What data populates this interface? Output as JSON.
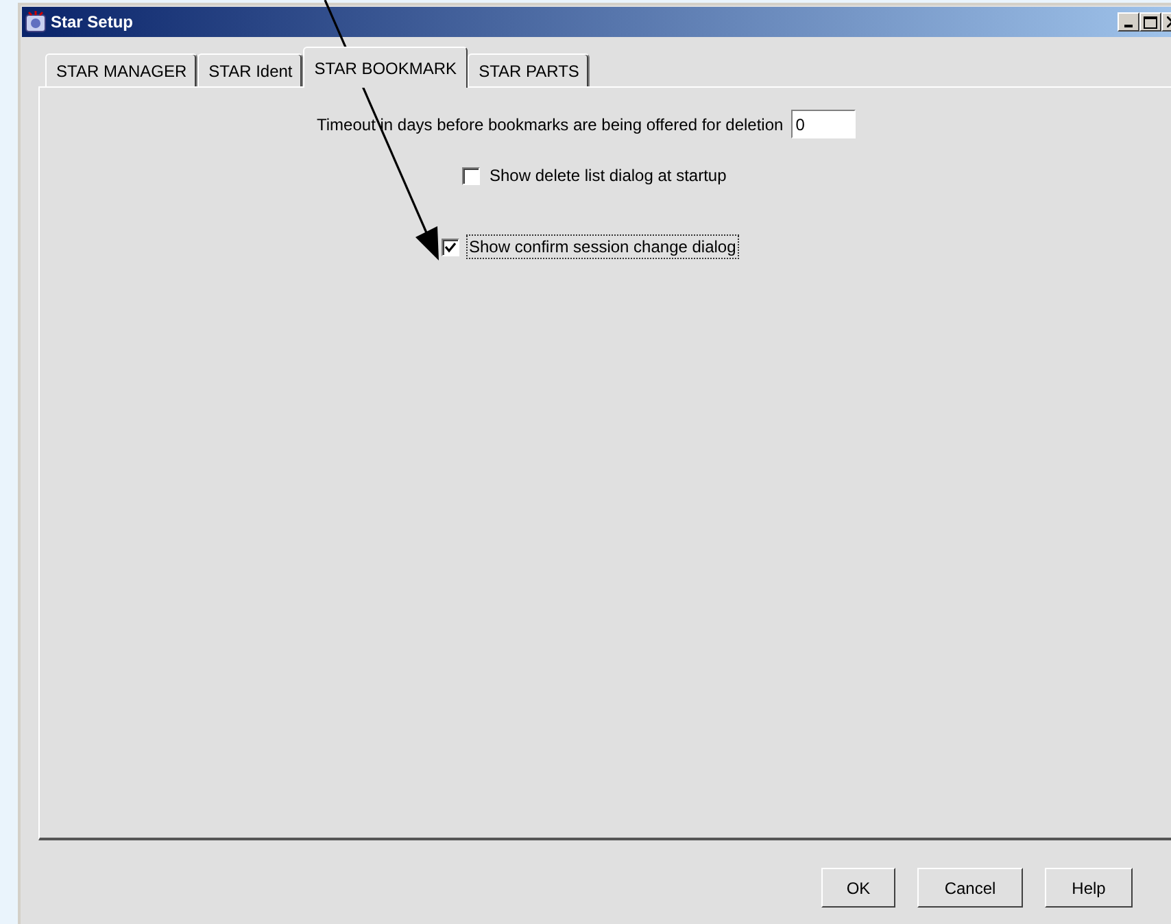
{
  "window": {
    "title": "Star Setup"
  },
  "tabs": [
    {
      "label": "STAR MANAGER",
      "selected": false
    },
    {
      "label": "STAR Ident",
      "selected": false
    },
    {
      "label": "STAR BOOKMARK",
      "selected": true
    },
    {
      "label": "STAR PARTS",
      "selected": false
    }
  ],
  "timeout": {
    "label": "Timeout in days before bookmarks are being offered for deletion",
    "value": "0"
  },
  "options": [
    {
      "label": "Show delete list dialog at startup",
      "checked": false,
      "focused": false
    },
    {
      "label": "Show confirm session change dialog",
      "checked": true,
      "focused": true
    }
  ],
  "buttons": [
    "OK",
    "Cancel",
    "Help"
  ]
}
